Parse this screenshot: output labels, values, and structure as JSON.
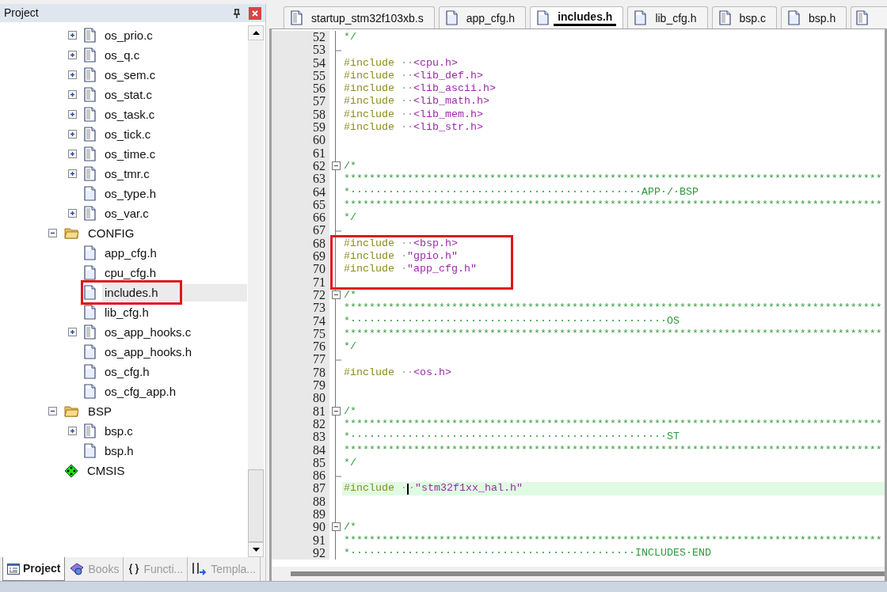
{
  "project_panel": {
    "title": "Project",
    "tree": [
      {
        "children": [
          {
            "label": "os_prio.c",
            "kind": "source",
            "expanded": false,
            "selected": false,
            "outlined": false
          },
          {
            "label": "os_q.c",
            "kind": "source",
            "expanded": false,
            "selected": false,
            "outlined": false
          },
          {
            "label": "os_sem.c",
            "kind": "source",
            "expanded": false,
            "selected": false,
            "outlined": false
          },
          {
            "label": "os_stat.c",
            "kind": "source",
            "expanded": false,
            "selected": false,
            "outlined": false
          },
          {
            "label": "os_task.c",
            "kind": "source",
            "expanded": false,
            "selected": false,
            "outlined": false
          },
          {
            "label": "os_tick.c",
            "kind": "source",
            "expanded": false,
            "selected": false,
            "outlined": false
          },
          {
            "label": "os_time.c",
            "kind": "source",
            "expanded": false,
            "selected": false,
            "outlined": false
          },
          {
            "label": "os_tmr.c",
            "kind": "source",
            "expanded": false,
            "selected": false,
            "outlined": false
          },
          {
            "label": "os_type.h",
            "kind": "header",
            "selected": false,
            "outlined": false
          },
          {
            "label": "os_var.c",
            "kind": "source",
            "expanded": false,
            "selected": false,
            "outlined": false
          }
        ]
      },
      {
        "label": "CONFIG",
        "kind": "folder",
        "expanded": true,
        "selected": false,
        "outlined": false,
        "children": [
          {
            "label": "app_cfg.h",
            "kind": "header",
            "selected": false,
            "outlined": false
          },
          {
            "label": "cpu_cfg.h",
            "kind": "header",
            "selected": false,
            "outlined": false
          },
          {
            "label": "includes.h",
            "kind": "header",
            "selected": true,
            "outlined": true
          },
          {
            "label": "lib_cfg.h",
            "kind": "header",
            "selected": false,
            "outlined": false
          },
          {
            "label": "os_app_hooks.c",
            "kind": "source",
            "expanded": false,
            "selected": false,
            "outlined": false
          },
          {
            "label": "os_app_hooks.h",
            "kind": "header",
            "selected": false,
            "outlined": false
          },
          {
            "label": "os_cfg.h",
            "kind": "header",
            "selected": false,
            "outlined": false
          },
          {
            "label": "os_cfg_app.h",
            "kind": "header",
            "selected": false,
            "outlined": false
          }
        ]
      },
      {
        "label": "BSP",
        "kind": "folder",
        "expanded": true,
        "selected": false,
        "outlined": false,
        "children": [
          {
            "label": "bsp.c",
            "kind": "source",
            "expanded": false,
            "selected": false,
            "outlined": false
          },
          {
            "label": "bsp.h",
            "kind": "header",
            "selected": false,
            "outlined": false
          }
        ]
      },
      {
        "label": "CMSIS",
        "kind": "component",
        "selected": false,
        "outlined": false
      }
    ],
    "bottom_tabs": [
      {
        "label": "Project",
        "kind": "project",
        "selected": true
      },
      {
        "label": "Books",
        "kind": "books",
        "selected": false
      },
      {
        "label": "Functi...",
        "kind": "functions",
        "selected": false
      },
      {
        "label": "Templa...",
        "kind": "templates",
        "selected": false
      }
    ]
  },
  "editor": {
    "tabs": [
      {
        "label": "startup_stm32f103xb.s",
        "kind": "source",
        "selected": false
      },
      {
        "label": "app_cfg.h",
        "kind": "header",
        "selected": false
      },
      {
        "label": "includes.h",
        "kind": "header",
        "selected": true
      },
      {
        "label": "lib_cfg.h",
        "kind": "header",
        "selected": false
      },
      {
        "label": "bsp.c",
        "kind": "source",
        "selected": false
      },
      {
        "label": "bsp.h",
        "kind": "header",
        "selected": false
      }
    ],
    "lines": [
      {
        "number": "52",
        "kind": "plain",
        "segments": [
          {
            "kind": "comment",
            "text": "*/"
          }
        ]
      },
      {
        "number": "53",
        "kind": "fold_end"
      },
      {
        "number": "54",
        "kind": "plain",
        "segments": [
          {
            "kind": "directive",
            "text": "#include"
          },
          {
            "kind": "space",
            "text": " ··"
          },
          {
            "kind": "path",
            "text": "<cpu.h>"
          }
        ]
      },
      {
        "number": "55",
        "kind": "plain",
        "segments": [
          {
            "kind": "directive",
            "text": "#include"
          },
          {
            "kind": "space",
            "text": " ··"
          },
          {
            "kind": "path",
            "text": "<lib_def.h>"
          }
        ]
      },
      {
        "number": "56",
        "kind": "plain",
        "segments": [
          {
            "kind": "directive",
            "text": "#include"
          },
          {
            "kind": "space",
            "text": " ··"
          },
          {
            "kind": "path",
            "text": "<lib_ascii.h>"
          }
        ]
      },
      {
        "number": "57",
        "kind": "plain",
        "segments": [
          {
            "kind": "directive",
            "text": "#include"
          },
          {
            "kind": "space",
            "text": " ··"
          },
          {
            "kind": "path",
            "text": "<lib_math.h>"
          }
        ]
      },
      {
        "number": "58",
        "kind": "plain",
        "segments": [
          {
            "kind": "directive",
            "text": "#include"
          },
          {
            "kind": "space",
            "text": " ··"
          },
          {
            "kind": "path",
            "text": "<lib_mem.h>"
          }
        ]
      },
      {
        "number": "59",
        "kind": "plain",
        "segments": [
          {
            "kind": "directive",
            "text": "#include"
          },
          {
            "kind": "space",
            "text": " ··"
          },
          {
            "kind": "path",
            "text": "<lib_str.h>"
          }
        ]
      },
      {
        "number": "60",
        "kind": "plain"
      },
      {
        "number": "61",
        "kind": "plain"
      },
      {
        "number": "62",
        "kind": "fold_start",
        "segments": [
          {
            "kind": "comment",
            "text": "/*"
          }
        ]
      },
      {
        "number": "63",
        "kind": "plain",
        "segments": [
          {
            "kind": "comment",
            "text": "*************************************************************************************"
          }
        ]
      },
      {
        "number": "64",
        "kind": "plain",
        "segments": [
          {
            "kind": "comment",
            "text": "*··············································APP·/·BSP"
          }
        ]
      },
      {
        "number": "65",
        "kind": "plain",
        "segments": [
          {
            "kind": "comment",
            "text": "*************************************************************************************"
          }
        ]
      },
      {
        "number": "66",
        "kind": "plain",
        "segments": [
          {
            "kind": "comment",
            "text": "*/"
          }
        ]
      },
      {
        "number": "67",
        "kind": "fold_end"
      },
      {
        "number": "68",
        "kind": "plain",
        "outlined": true,
        "segments": [
          {
            "kind": "directive",
            "text": "#include"
          },
          {
            "kind": "space",
            "text": " ··"
          },
          {
            "kind": "path",
            "text": "<bsp.h>"
          }
        ]
      },
      {
        "number": "69",
        "kind": "plain",
        "outlined": true,
        "segments": [
          {
            "kind": "directive",
            "text": "#include"
          },
          {
            "kind": "space",
            "text": " ·"
          },
          {
            "kind": "path",
            "text": "\"gpio.h\""
          }
        ]
      },
      {
        "number": "70",
        "kind": "plain",
        "outlined": true,
        "segments": [
          {
            "kind": "directive",
            "text": "#include"
          },
          {
            "kind": "space",
            "text": " ·"
          },
          {
            "kind": "path",
            "text": "\"app_cfg.h\""
          }
        ]
      },
      {
        "number": "71",
        "kind": "plain",
        "outlined": true
      },
      {
        "number": "72",
        "kind": "fold_start",
        "segments": [
          {
            "kind": "comment",
            "text": "/*"
          }
        ]
      },
      {
        "number": "73",
        "kind": "plain",
        "segments": [
          {
            "kind": "comment",
            "text": "*************************************************************************************"
          }
        ]
      },
      {
        "number": "74",
        "kind": "plain",
        "segments": [
          {
            "kind": "comment",
            "text": "*··················································OS"
          }
        ]
      },
      {
        "number": "75",
        "kind": "plain",
        "segments": [
          {
            "kind": "comment",
            "text": "*************************************************************************************"
          }
        ]
      },
      {
        "number": "76",
        "kind": "plain",
        "segments": [
          {
            "kind": "comment",
            "text": "*/"
          }
        ]
      },
      {
        "number": "77",
        "kind": "fold_end"
      },
      {
        "number": "78",
        "kind": "plain",
        "segments": [
          {
            "kind": "directive",
            "text": "#include"
          },
          {
            "kind": "space",
            "text": " ··"
          },
          {
            "kind": "path",
            "text": "<os.h>"
          }
        ]
      },
      {
        "number": "79",
        "kind": "plain"
      },
      {
        "number": "80",
        "kind": "plain"
      },
      {
        "number": "81",
        "kind": "fold_start",
        "segments": [
          {
            "kind": "comment",
            "text": "/*"
          }
        ]
      },
      {
        "number": "82",
        "kind": "plain",
        "segments": [
          {
            "kind": "comment",
            "text": "*************************************************************************************"
          }
        ]
      },
      {
        "number": "83",
        "kind": "plain",
        "segments": [
          {
            "kind": "comment",
            "text": "*··················································ST"
          }
        ]
      },
      {
        "number": "84",
        "kind": "plain",
        "segments": [
          {
            "kind": "comment",
            "text": "*************************************************************************************"
          }
        ]
      },
      {
        "number": "85",
        "kind": "plain",
        "segments": [
          {
            "kind": "comment",
            "text": "*/"
          }
        ]
      },
      {
        "number": "86",
        "kind": "fold_end"
      },
      {
        "number": "87",
        "kind": "plain",
        "current": true,
        "segments": [
          {
            "kind": "directive",
            "text": "#include"
          },
          {
            "kind": "space",
            "text": " ·",
            "cursor_after": true
          },
          {
            "kind": "space",
            "text": "·"
          },
          {
            "kind": "path",
            "text": "\"stm32f1xx_hal.h\""
          }
        ]
      },
      {
        "number": "88",
        "kind": "plain"
      },
      {
        "number": "89",
        "kind": "plain"
      },
      {
        "number": "90",
        "kind": "fold_start",
        "segments": [
          {
            "kind": "comment",
            "text": "/*"
          }
        ]
      },
      {
        "number": "91",
        "kind": "plain",
        "segments": [
          {
            "kind": "comment",
            "text": "*************************************************************************************"
          }
        ]
      },
      {
        "number": "92",
        "kind": "plain",
        "segments": [
          {
            "kind": "comment",
            "text": "*·············································INCLUDES·END"
          }
        ]
      }
    ]
  }
}
